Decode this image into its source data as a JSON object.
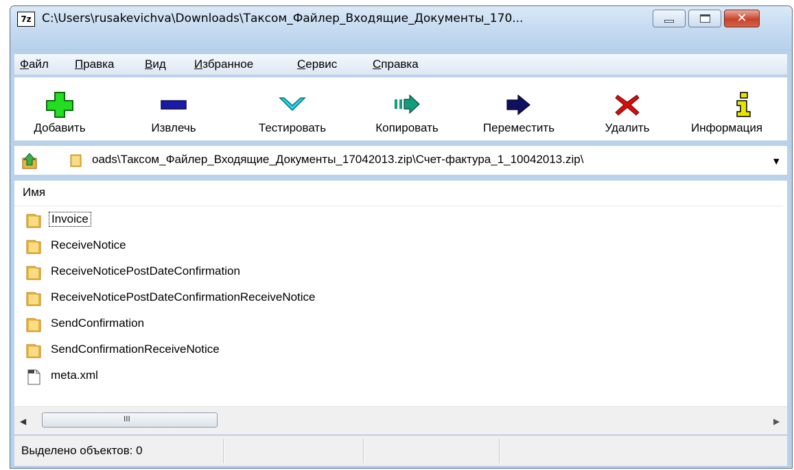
{
  "window": {
    "app_icon_text": "7z",
    "title": "C:\\Users\\rusakevichva\\Downloads\\Таксом_Файлер_Входящие_Документы_170..."
  },
  "menu": {
    "items": [
      "Файл",
      "Правка",
      "Вид",
      "Избранное",
      "Сервис",
      "Справка"
    ]
  },
  "toolbar": {
    "add": "Добавить",
    "extract": "Извлечь",
    "test": "Тестировать",
    "copy": "Копировать",
    "move": "Переместить",
    "delete": "Удалить",
    "info": "Информация"
  },
  "address": {
    "path": "oads\\Таксом_Файлер_Входящие_Документы_17042013.zip\\Счет-фактура_1_10042013.zip\\"
  },
  "list": {
    "column_name": "Имя",
    "items": [
      {
        "name": "Invoice",
        "type": "folder"
      },
      {
        "name": "ReceiveNotice",
        "type": "folder"
      },
      {
        "name": "ReceiveNoticePostDateConfirmation",
        "type": "folder"
      },
      {
        "name": "ReceiveNoticePostDateConfirmationReceiveNotice",
        "type": "folder"
      },
      {
        "name": "SendConfirmation",
        "type": "folder"
      },
      {
        "name": "SendConfirmationReceiveNotice",
        "type": "folder"
      },
      {
        "name": "meta.xml",
        "type": "xml-file"
      }
    ]
  },
  "scrollbar": {
    "grip": "III"
  },
  "status": {
    "selected": "Выделено объектов: 0"
  },
  "colors": {
    "titlebar": "#c6dbf1",
    "close_button": "#c7432a",
    "add_icon": "#22dd22",
    "extract_icon": "#1a1aa8",
    "test_icon": "#20d8e8",
    "copy_icon": "#159b7e",
    "move_icon": "#101060",
    "delete_icon": "#d01010",
    "info_icon": "#e6e600",
    "folder": "#f2c44a"
  }
}
